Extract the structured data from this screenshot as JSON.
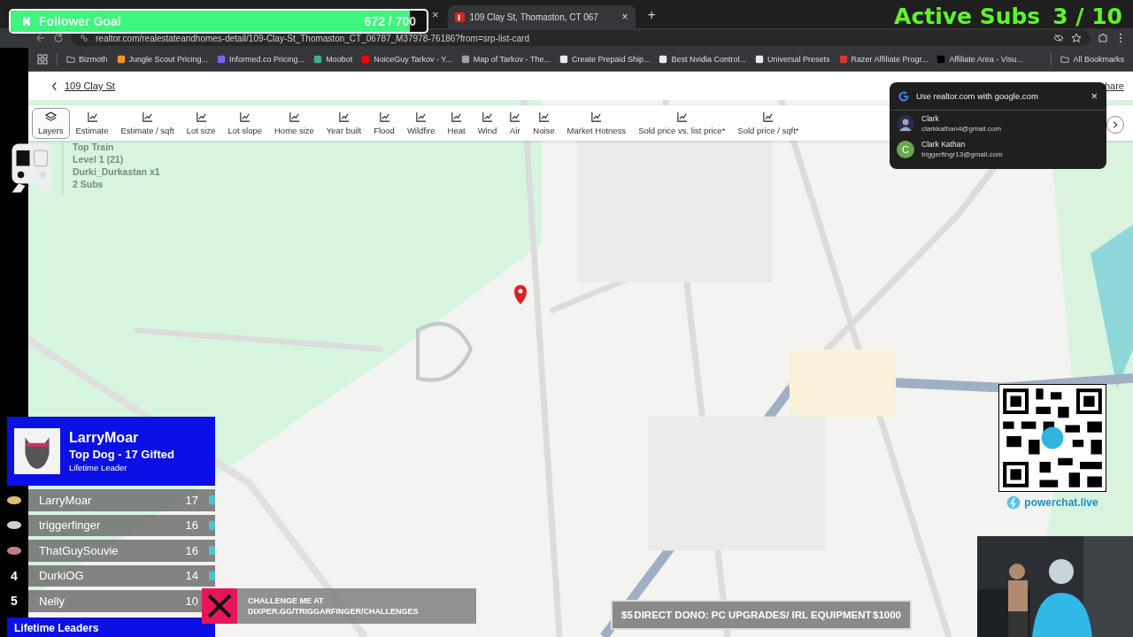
{
  "browser": {
    "tab": {
      "title": "109 Clay St, Thomaston, CT 067",
      "close": "×"
    },
    "hidden_tab_close": "×",
    "new_tab": "+",
    "url": "realtor.com/realestateandhomes-detail/109-Clay-St_Thomaston_CT_06787_M37978-76186?from=srp-list-card",
    "bookmarks": [
      {
        "label": "Bizmoth",
        "kind": "folder"
      },
      {
        "label": "Jungle Scout Pricing...",
        "kind": "site",
        "color": "#f7941d"
      },
      {
        "label": "Informed.co Pricing...",
        "kind": "site",
        "color": "#7b61ff"
      },
      {
        "label": "Moobot",
        "kind": "site",
        "color": "#3fb27f"
      },
      {
        "label": "NoiceGuy Tarkov - Y...",
        "kind": "site",
        "color": "#ff0000"
      },
      {
        "label": "Map of Tarkov - The...",
        "kind": "site",
        "color": "#9aa0a6"
      },
      {
        "label": "Create Prepaid Ship...",
        "kind": "site",
        "color": "#e8eaed"
      },
      {
        "label": "Best Nvidia Control...",
        "kind": "site",
        "color": "#e8eaed"
      },
      {
        "label": "Universal Presets",
        "kind": "site",
        "color": "#e8eaed"
      },
      {
        "label": "Razer Affiliate Progr...",
        "kind": "site",
        "color": "#d33"
      },
      {
        "label": "Affiliate Area - Visu...",
        "kind": "site",
        "color": "#000000"
      }
    ],
    "all_bookmarks": "All Bookmarks"
  },
  "page": {
    "back_link": "109 Clay St",
    "share": "hare",
    "layers": [
      {
        "label": "Layers",
        "selected": true
      },
      {
        "label": "Estimate",
        "selected": false
      },
      {
        "label": "Estimate / sqft",
        "selected": false
      },
      {
        "label": "Lot size",
        "selected": false
      },
      {
        "label": "Lot slope",
        "selected": false
      },
      {
        "label": "Home size",
        "selected": false
      },
      {
        "label": "Year built",
        "selected": false
      },
      {
        "label": "Flood",
        "selected": false
      },
      {
        "label": "Wildfire",
        "selected": false
      },
      {
        "label": "Heat",
        "selected": false
      },
      {
        "label": "Wind",
        "selected": false
      },
      {
        "label": "Air",
        "selected": false
      },
      {
        "label": "Noise",
        "selected": false
      },
      {
        "label": "Market Hotness",
        "selected": false
      },
      {
        "label": "Sold price vs. list price*",
        "selected": false
      },
      {
        "label": "Sold price / sqft*",
        "selected": false
      }
    ]
  },
  "google_popup": {
    "title": "Use realtor.com with google.com",
    "close": "×",
    "accounts": [
      {
        "name": "Clark",
        "email": "clarkkathan4@gmail.com"
      },
      {
        "name": "Clark Kathan",
        "email": "triggerfingr13@gmail.com",
        "kind": "letter",
        "initial": "C",
        "color": "#6aa84f"
      }
    ]
  },
  "follower_goal": {
    "label": "Follower Goal",
    "count": "672 / 700",
    "level": 0.96
  },
  "active_subs": {
    "label": "Active Subs",
    "count": "3 / 10"
  },
  "top_train": {
    "title": "Top Train",
    "level": "Level 1  (21)",
    "user": "Durki_Durkastan x1",
    "subs": "2 Subs"
  },
  "leaderboard": {
    "leader": {
      "name": "LarryMoar",
      "title": "Top Dog - 17 Gifted",
      "subtitle": "Lifetime Leader"
    },
    "rows": [
      {
        "kind": "badge",
        "color": "#e0c070",
        "name": "LarryMoar",
        "count": "17"
      },
      {
        "kind": "badge",
        "color": "#cfcfcf",
        "name": "triggerfinger",
        "count": "16"
      },
      {
        "kind": "badge",
        "color": "#c08080",
        "name": "ThatGuySouvie",
        "count": "16"
      },
      {
        "kind": "number",
        "rank": "4",
        "name": "DurkiOG",
        "count": "14"
      },
      {
        "kind": "number",
        "rank": "5",
        "name": "Nelly",
        "count": "10"
      }
    ],
    "footer": "Lifetime Leaders"
  },
  "challenge": {
    "line_1": "CHALLENGE ME AT",
    "line_2": "DIXPER.GG/TRIGGARFINGER/CHALLENGES"
  },
  "donation_goal": {
    "min": "$5",
    "title": "DIRECT DONO: PC UPGRADES/ IRL EQUIPMENT",
    "max": "$1000",
    "level": 0
  },
  "qr": {
    "brand": "powerchat.live"
  }
}
